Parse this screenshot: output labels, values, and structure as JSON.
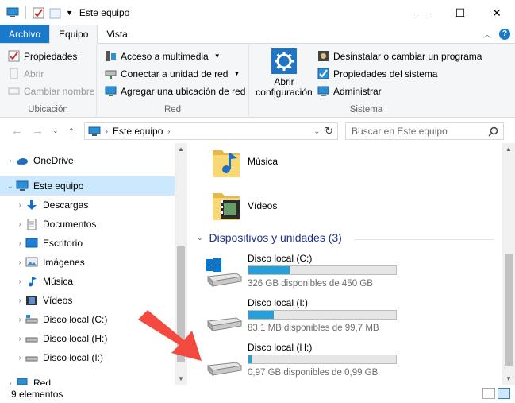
{
  "window": {
    "title": "Este equipo",
    "controls": {
      "minimize": "—",
      "maximize": "☐",
      "close": "✕"
    }
  },
  "tabs": [
    {
      "label": "Archivo",
      "kind": "file"
    },
    {
      "label": "Equipo",
      "kind": "active"
    },
    {
      "label": "Vista",
      "kind": "normal"
    }
  ],
  "ribbon": {
    "ubicacion": {
      "label": "Ubicación",
      "items": [
        {
          "label": "Propiedades",
          "enabled": true
        },
        {
          "label": "Abrir",
          "enabled": false
        },
        {
          "label": "Cambiar nombre",
          "enabled": false
        }
      ]
    },
    "red": {
      "label": "Red",
      "items": [
        {
          "label": "Acceso a multimedia"
        },
        {
          "label": "Conectar a unidad de red"
        },
        {
          "label": "Agregar una ubicación de red"
        }
      ]
    },
    "sistema": {
      "label": "Sistema",
      "big_button_line1": "Abrir",
      "big_button_line2": "configuración",
      "items": [
        {
          "label": "Desinstalar o cambiar un programa"
        },
        {
          "label": "Propiedades del sistema"
        },
        {
          "label": "Administrar"
        }
      ]
    }
  },
  "address": {
    "path": "Este equipo",
    "search_placeholder": "Buscar en Este equipo"
  },
  "nav": {
    "items": [
      {
        "label": "OneDrive",
        "icon": "cloud-icon",
        "level": 0,
        "selected": false
      },
      {
        "label": "Este equipo",
        "icon": "computer-icon",
        "level": 0,
        "selected": true,
        "expanded": true
      },
      {
        "label": "Descargas",
        "icon": "download-icon",
        "level": 1
      },
      {
        "label": "Documentos",
        "icon": "documents-icon",
        "level": 1
      },
      {
        "label": "Escritorio",
        "icon": "desktop-icon",
        "level": 1
      },
      {
        "label": "Imágenes",
        "icon": "pictures-icon",
        "level": 1
      },
      {
        "label": "Música",
        "icon": "music-icon",
        "level": 1
      },
      {
        "label": "Vídeos",
        "icon": "videos-icon",
        "level": 1
      },
      {
        "label": "Disco local (C:)",
        "icon": "drive-icon",
        "level": 1
      },
      {
        "label": "Disco local (H:)",
        "icon": "drive-icon",
        "level": 1
      },
      {
        "label": "Disco local (I:)",
        "icon": "drive-icon",
        "level": 1
      },
      {
        "label": "Red",
        "icon": "network-icon",
        "level": 0
      }
    ]
  },
  "content": {
    "folders": [
      {
        "label": "Música",
        "icon": "music-folder-icon"
      },
      {
        "label": "Vídeos",
        "icon": "videos-folder-icon"
      }
    ],
    "devices_header": "Dispositivos y unidades (3)",
    "drives": [
      {
        "name": "Disco local (C:)",
        "free_text": "326 GB disponibles de 450 GB",
        "used_fraction": 0.28,
        "icon": "windows-drive-icon"
      },
      {
        "name": "Disco local (I:)",
        "free_text": "83,1 MB disponibles de 99,7 MB",
        "used_fraction": 0.17,
        "icon": "drive-icon"
      },
      {
        "name": "Disco local (H:)",
        "free_text": "0,97 GB disponibles de 0,99 GB",
        "used_fraction": 0.02,
        "icon": "drive-icon"
      }
    ]
  },
  "status": {
    "count": "9 elementos"
  },
  "colors": {
    "accent": "#1979ca",
    "selection": "#cce8ff",
    "drive_fill": "#26a0da",
    "section_header": "#1e3287",
    "arrow": "#f24a3f"
  }
}
